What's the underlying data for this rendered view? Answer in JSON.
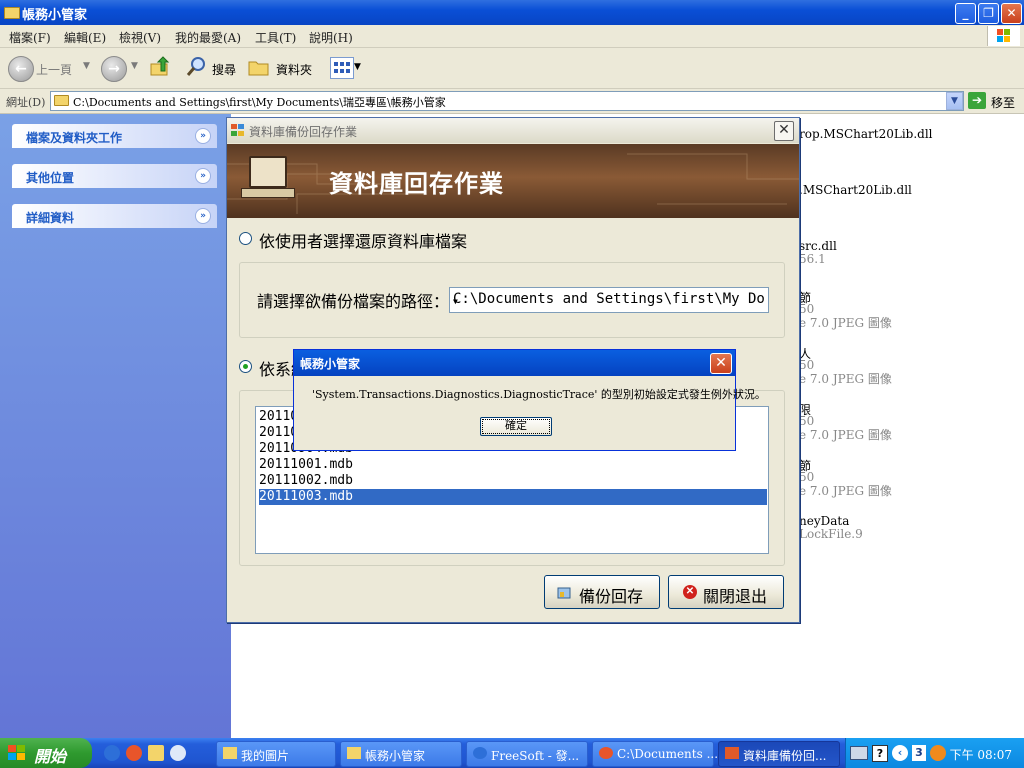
{
  "window": {
    "title": "帳務小管家"
  },
  "menu": [
    "檔案(F)",
    "編輯(E)",
    "檢視(V)",
    "我的最愛(A)",
    "工具(T)",
    "說明(H)"
  ],
  "toolbar": {
    "back": "上一頁",
    "search": "搜尋",
    "folders": "資料夾"
  },
  "address": {
    "label": "網址(D)",
    "path": "C:\\Documents and Settings\\first\\My Documents\\瑞亞專區\\帳務小管家",
    "go": "移至"
  },
  "taskpane": [
    "檔案及資料夾工作",
    "其他位置",
    "詳細資料"
  ],
  "files": [
    {
      "line1": "rop.MSChart20Lib.dll",
      "line2": ""
    },
    {
      "line1": ".MSChart20Lib.dll",
      "line2": ""
    },
    {
      "line1": "src.dll",
      "line2": "56.1"
    },
    {
      "line1": "節",
      "line2": "50",
      "line3": "e 7.0 JPEG 圖像"
    },
    {
      "line1": "人",
      "line2": "50",
      "line3": "e 7.0 JPEG 圖像"
    },
    {
      "line1": "限",
      "line2": "50",
      "line3": "e 7.0 JPEG 圖像"
    },
    {
      "line1": "節",
      "line2": "50",
      "line3": "e 7.0 JPEG 圖像"
    },
    {
      "line1": "neyData",
      "line2": "LockFile.9"
    }
  ],
  "dialog": {
    "title": "資料庫備份回存作業",
    "banner": "資料庫回存作業",
    "option1": "依使用者選擇還原資料庫檔案",
    "path_label": "請選擇欲備份檔案的路徑：",
    "path_value": "C:\\Documents and Settings\\first\\My Do",
    "option2": "依系統",
    "files": [
      "20110",
      "20110",
      "20110904.mdb",
      "20111001.mdb",
      "20111002.mdb",
      "20111003.mdb"
    ],
    "restore_button": "備份回存",
    "exit_button": "關閉退出"
  },
  "message": {
    "title": "帳務小管家",
    "text": "'System.Transactions.Diagnostics.DiagnosticTrace' 的型別初始設定式發生例外狀況。",
    "ok": "確定"
  },
  "taskbar": {
    "start": "開始",
    "tasks": [
      "我的圖片",
      "帳務小管家",
      "FreeSoft - 發...",
      "C:\\Documents ...",
      "資料庫備份回..."
    ],
    "tray_badge": "3",
    "clock": "下午 08:07"
  },
  "colors": {
    "xp_blue": "#0a4fd6",
    "selection": "#316ac5",
    "dialog_bg": "#ece9d8"
  }
}
